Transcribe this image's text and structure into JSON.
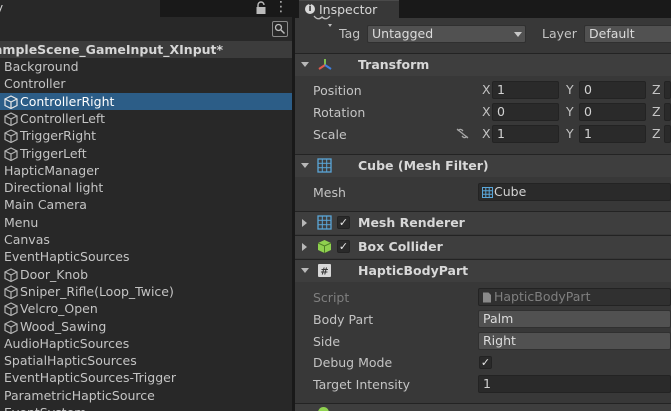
{
  "hierarchy": {
    "tab_label": "y",
    "scene_name": "ampleScene_GameInput_XInput*",
    "items": [
      {
        "label": "Background",
        "cube": false,
        "indent": 0,
        "selected": false
      },
      {
        "label": "Controller",
        "cube": false,
        "indent": 0,
        "selected": false
      },
      {
        "label": "ControllerRight",
        "cube": true,
        "indent": 1,
        "selected": true
      },
      {
        "label": "ControllerLeft",
        "cube": true,
        "indent": 1,
        "selected": false
      },
      {
        "label": "TriggerRight",
        "cube": true,
        "indent": 1,
        "selected": false
      },
      {
        "label": "TriggerLeft",
        "cube": true,
        "indent": 1,
        "selected": false
      },
      {
        "label": "HapticManager",
        "cube": false,
        "indent": 0,
        "selected": false
      },
      {
        "label": "Directional light",
        "cube": false,
        "indent": 0,
        "selected": false
      },
      {
        "label": "Main Camera",
        "cube": false,
        "indent": 0,
        "selected": false
      },
      {
        "label": "Menu",
        "cube": false,
        "indent": 0,
        "selected": false
      },
      {
        "label": "Canvas",
        "cube": false,
        "indent": 0,
        "selected": false
      },
      {
        "label": "EventHapticSources",
        "cube": false,
        "indent": 0,
        "selected": false
      },
      {
        "label": "Door_Knob",
        "cube": true,
        "indent": 1,
        "selected": false
      },
      {
        "label": "Sniper_Rifle(Loop_Twice)",
        "cube": true,
        "indent": 1,
        "selected": false
      },
      {
        "label": "Velcro_Open",
        "cube": true,
        "indent": 1,
        "selected": false
      },
      {
        "label": "Wood_Sawing",
        "cube": true,
        "indent": 1,
        "selected": false
      },
      {
        "label": "AudioHapticSources",
        "cube": false,
        "indent": 0,
        "selected": false
      },
      {
        "label": "SpatialHapticSources",
        "cube": false,
        "indent": 0,
        "selected": false
      },
      {
        "label": "EventHapticSources-Trigger",
        "cube": false,
        "indent": 0,
        "selected": false
      },
      {
        "label": "ParametricHapticSource",
        "cube": false,
        "indent": 0,
        "selected": false
      },
      {
        "label": "EventSystem",
        "cube": false,
        "indent": 0,
        "selected": false
      }
    ]
  },
  "inspector": {
    "tab_label": "Inspector",
    "tag_label": "Tag",
    "tag_value": "Untagged",
    "layer_label": "Layer",
    "layer_value": "Default",
    "transform": {
      "title": "Transform",
      "rows": [
        {
          "label": "Position",
          "x": "1",
          "y": "0",
          "z_axis": "Z"
        },
        {
          "label": "Rotation",
          "x": "0",
          "y": "0",
          "z_axis": "Z"
        },
        {
          "label": "Scale",
          "x": "1",
          "y": "1",
          "z_axis": "Z"
        }
      ],
      "x_axis": "X",
      "y_axis": "Y"
    },
    "mesh_filter": {
      "title": "Cube (Mesh Filter)",
      "mesh_label": "Mesh",
      "mesh_value": "Cube"
    },
    "mesh_renderer": {
      "title": "Mesh Renderer",
      "enabled": true
    },
    "box_collider": {
      "title": "Box Collider",
      "enabled": true
    },
    "haptic_body_part": {
      "title": "HapticBodyPart",
      "script_label": "Script",
      "script_value": "HapticBodyPart",
      "body_part_label": "Body Part",
      "body_part_value": "Palm",
      "side_label": "Side",
      "side_value": "Right",
      "debug_mode_label": "Debug Mode",
      "debug_mode_checked": true,
      "target_intensity_label": "Target Intensity",
      "target_intensity_value": "1"
    },
    "check_glyph": "✓"
  },
  "colors": {
    "selection": "#2c5d87",
    "transform_x": "#e05a4c",
    "transform_y": "#7ec050",
    "transform_z": "#3d7fe0",
    "mesh_icon": "#5aa6d8",
    "collider_icon": "#8fd14f"
  }
}
